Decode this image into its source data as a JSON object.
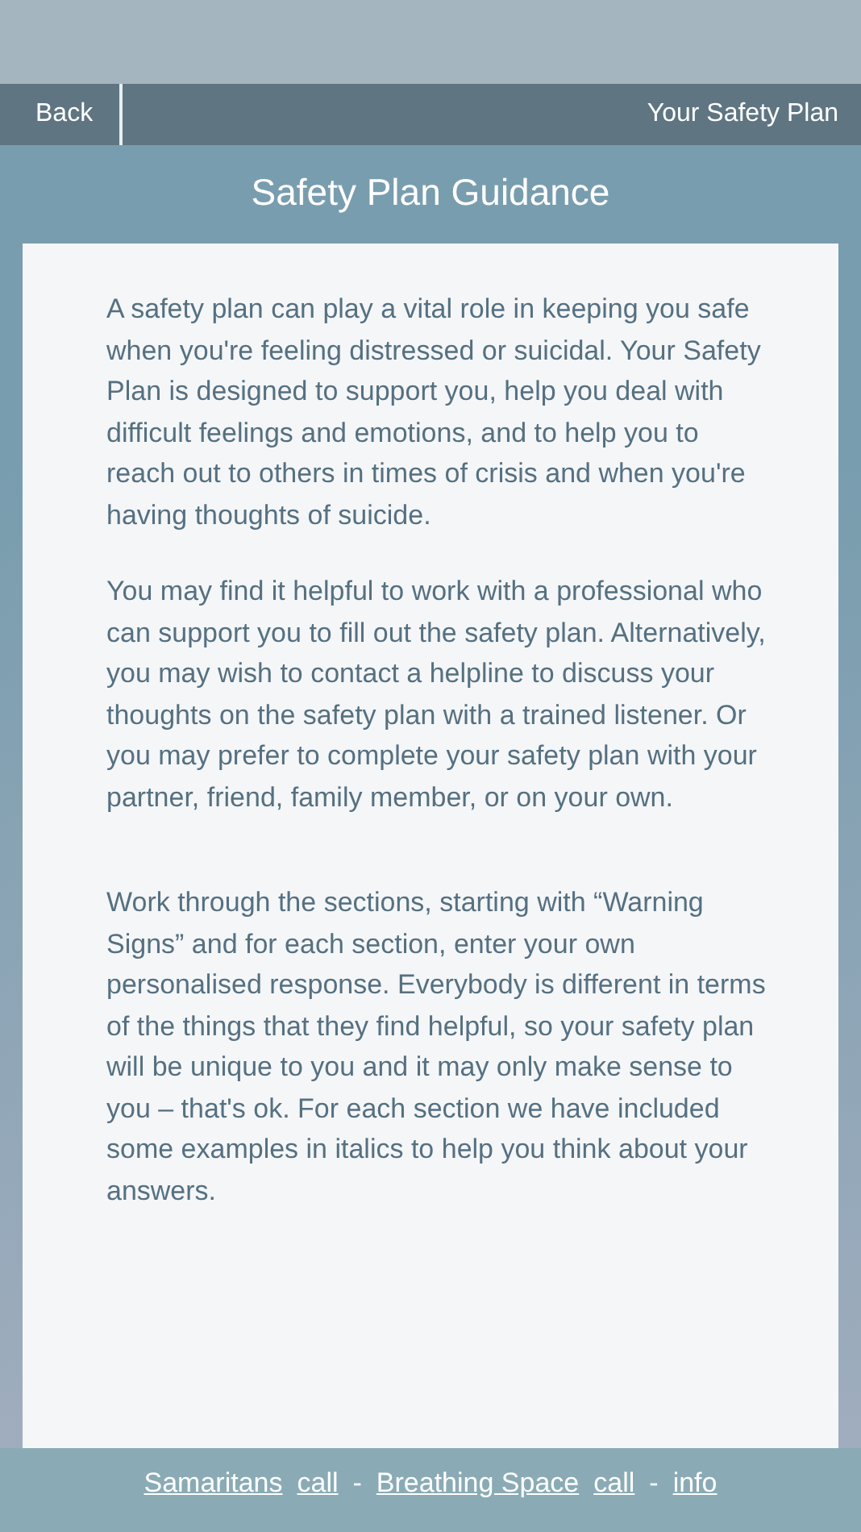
{
  "nav_bar": {
    "back": "Back",
    "title": "Your Safety Plan"
  },
  "heading": "Safety Plan Guidance",
  "paragraphs": [
    "A safety plan can play a vital role in keeping you safe when you're feeling distressed or suicidal. Your Safety Plan is designed to support you, help you deal with difficult feelings and emotions, and to help you to reach out to others in times of crisis and when you're having thoughts of suicide.",
    "You may find it helpful to work with a professional who can support you to fill out the safety plan. Alternatively, you may wish to contact a helpline to discuss your thoughts on the safety plan with a trained listener. Or you may prefer to complete your safety plan with your partner, friend, family member, or on your own.",
    "Work through the sections, starting with “Warning Signs” and for each section, enter your own personalised response. Everybody is different in terms of the things that they find helpful, so your safety plan will be unique to you and it may only make sense to you – that's ok. For each section we have included some examples in italics to help you think about your answers."
  ],
  "footer": [
    {
      "kind": "link",
      "text": "Samaritans"
    },
    {
      "kind": "link",
      "text": "call"
    },
    {
      "kind": "separator",
      "text": "-"
    },
    {
      "kind": "link",
      "text": "Breathing Space"
    },
    {
      "kind": "link",
      "text": "call"
    },
    {
      "kind": "separator",
      "text": "-"
    },
    {
      "kind": "link",
      "text": "info"
    }
  ]
}
